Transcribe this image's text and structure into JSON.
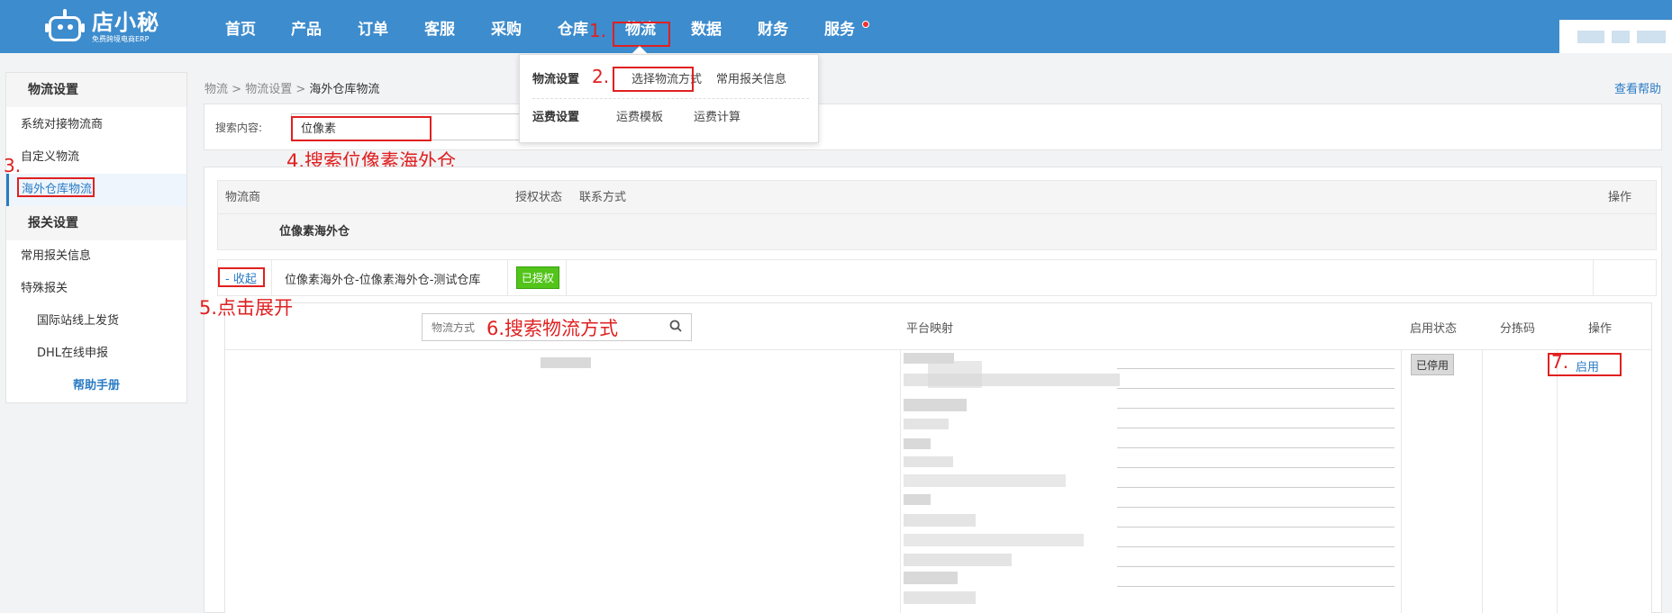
{
  "brand": {
    "name": "店小秘",
    "tagline": "免费跨境电商ERP"
  },
  "nav": {
    "items": [
      "首页",
      "产品",
      "订单",
      "客服",
      "采购",
      "仓库",
      "物流",
      "数据",
      "财务",
      "服务"
    ],
    "active": "物流"
  },
  "annotations": {
    "step1": "1.",
    "step2": "2.",
    "step3": "3.",
    "step4": "4.搜索位像素海外仓",
    "step5": "5.点击展开",
    "step6": "6.搜索物流方式",
    "step7": "7."
  },
  "sidebar": {
    "section1": "物流设置",
    "items1": [
      "系统对接物流商",
      "自定义物流",
      "海外仓库物流"
    ],
    "active_item": "海外仓库物流",
    "section2": "报关设置",
    "items2": [
      "常用报关信息",
      "特殊报关",
      "国际站线上发货",
      "DHL在线申报"
    ],
    "help": "帮助手册"
  },
  "breadcrumb": {
    "part1": "物流",
    "part2": "物流设置",
    "current": "海外仓库物流",
    "sep": ">"
  },
  "help_link": "查看帮助",
  "search": {
    "label": "搜索内容:",
    "value": "位像素"
  },
  "dropdown": {
    "row1_label": "物流设置",
    "row1_opt1": "选择物流方式",
    "row1_opt2": "常用报关信息",
    "row2_label": "运费设置",
    "row2_opt1": "运费模板",
    "row2_opt2": "运费计算"
  },
  "table": {
    "headers": {
      "provider": "物流商",
      "auth": "授权状态",
      "contact": "联系方式",
      "action": "操作"
    },
    "group_name": "位像素海外仓",
    "warehouse": {
      "collapse": "- 收起",
      "name": "位像素海外仓-位像素海外仓-测试仓库",
      "auth_status": "已授权"
    }
  },
  "sub_table": {
    "search_placeholder": "物流方式",
    "headers": {
      "mapping": "平台映射",
      "enable_status": "启用状态",
      "sort_code": "分拣码",
      "action": "操作"
    },
    "status": "已停用",
    "enable_action": "启用"
  },
  "colors": {
    "topbar": "#3d8ccd",
    "annotation": "#e02020",
    "link": "#2a7bc4",
    "authorized": "#52c41a"
  }
}
